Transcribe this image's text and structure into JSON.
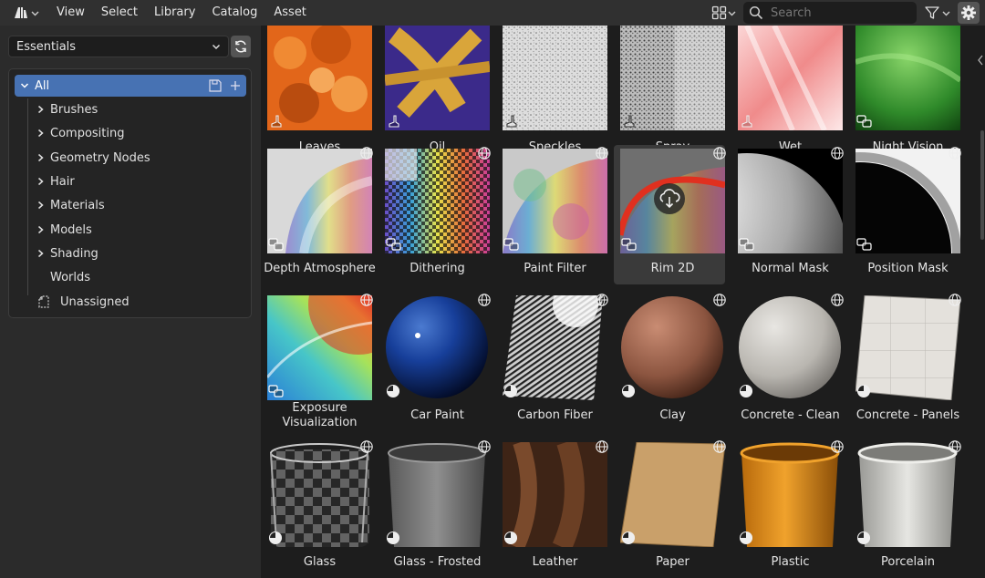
{
  "topbar": {
    "menu": [
      "View",
      "Select",
      "Library",
      "Catalog",
      "Asset"
    ],
    "search_placeholder": "Search"
  },
  "sidebar": {
    "library": "Essentials",
    "tree_root": "All",
    "catalogs": [
      "Brushes",
      "Compositing",
      "Geometry Nodes",
      "Hair",
      "Materials",
      "Models",
      "Shading",
      "Worlds"
    ],
    "unassigned": "Unassigned"
  },
  "assets": {
    "row1": [
      "Leaves",
      "Oil",
      "Speckles",
      "Spray",
      "Wet",
      "Night Vision"
    ],
    "row2": [
      "Depth Atmosphere",
      "Dithering",
      "Paint Filter",
      "Rim 2D",
      "Normal Mask",
      "Position Mask"
    ],
    "row3": [
      "Exposure Visualization",
      "Car Paint",
      "Carbon Fiber",
      "Clay",
      "Concrete - Clean",
      "Concrete - Panels"
    ],
    "row4": [
      "Glass",
      "Glass - Frosted",
      "Leather",
      "Paper",
      "Plastic",
      "Porcelain"
    ],
    "selected": "Rim 2D"
  },
  "colors": {
    "accent": "#4772b3",
    "selected_card": "#3a3a3a",
    "panel": "#2b2b2b",
    "background": "#1d1d1d"
  }
}
